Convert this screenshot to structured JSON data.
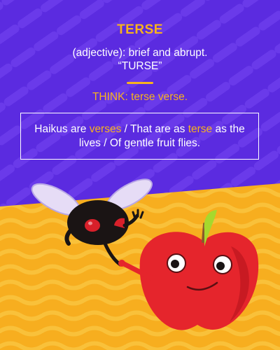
{
  "card": {
    "word": "TERSE",
    "definition_line1": "(adjective): brief and abrupt.",
    "definition_line2": "“TURSE”",
    "think_label": "THINK:",
    "think_text": "terse verse.",
    "haiku": {
      "part1": "Haikus are ",
      "highlight1": "verses",
      "part2": " / That are as ",
      "highlight2": "terse",
      "part3": " as the lives / Of gentle fruit flies."
    }
  },
  "colors": {
    "background_top": "#5b2be0",
    "background_bottom": "#f7ae1f",
    "accent": "#f7b21e",
    "text": "#ffffff",
    "apple_red": "#e5252c",
    "fly_body": "#1a1414"
  },
  "illustration": {
    "characters": [
      "fruit-fly",
      "apple"
    ]
  }
}
